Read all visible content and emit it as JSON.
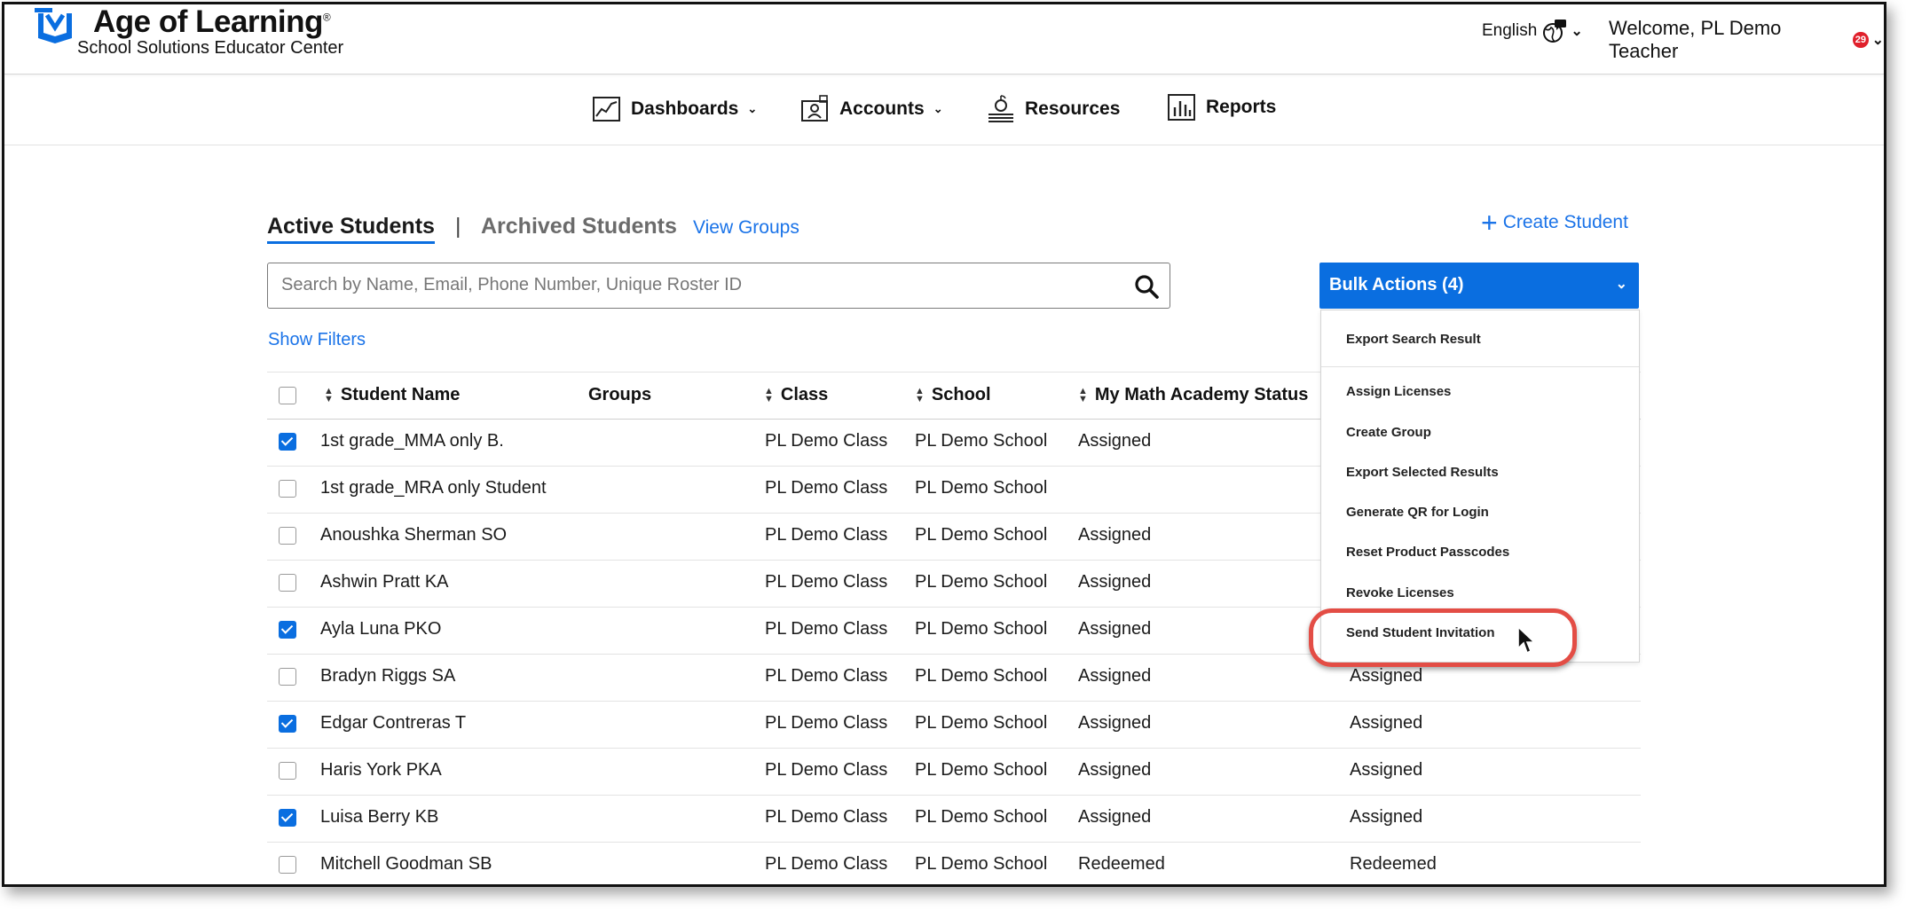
{
  "header": {
    "brand_title": "Age of Learning",
    "brand_registered": "®",
    "brand_subtitle": "School Solutions Educator Center",
    "language": "English",
    "welcome": "Welcome, PL Demo Teacher",
    "notification_count": "29"
  },
  "nav": {
    "dashboards": "Dashboards",
    "accounts": "Accounts",
    "resources": "Resources",
    "reports": "Reports"
  },
  "tabs": {
    "active": "Active Students",
    "separator": "|",
    "archived": "Archived Students",
    "groups": "View Groups"
  },
  "create_student": "Create Student",
  "search": {
    "placeholder": "Search by Name, Email, Phone Number, Unique Roster ID"
  },
  "show_filters": "Show Filters",
  "bulk_actions": {
    "label": "Bulk Actions (4)",
    "items": [
      "Export Search Result",
      "Assign Licenses",
      "Create Group",
      "Export Selected Results",
      "Generate QR for Login",
      "Reset Product Passcodes",
      "Revoke Licenses",
      "Send Student Invitation"
    ]
  },
  "table": {
    "headers": [
      "Student Name",
      "Groups",
      "Class",
      "School",
      "My Math Academy Status"
    ],
    "rows": [
      {
        "name": "1st grade_MMA only B.",
        "class": "PL Demo Class",
        "school": "PL Demo School",
        "status": "Assigned",
        "status2": "",
        "checked": true
      },
      {
        "name": "1st grade_MRA only Student",
        "class": "PL Demo Class",
        "school": "PL Demo School",
        "status": "",
        "status2": "",
        "checked": false
      },
      {
        "name": "Anoushka Sherman SO",
        "class": "PL Demo Class",
        "school": "PL Demo School",
        "status": "Assigned",
        "status2": "",
        "checked": false
      },
      {
        "name": "Ashwin Pratt KA",
        "class": "PL Demo Class",
        "school": "PL Demo School",
        "status": "Assigned",
        "status2": "",
        "checked": false
      },
      {
        "name": "Ayla Luna PKO",
        "class": "PL Demo Class",
        "school": "PL Demo School",
        "status": "Assigned",
        "status2": "",
        "checked": true
      },
      {
        "name": "Bradyn Riggs SA",
        "class": "PL Demo Class",
        "school": "PL Demo School",
        "status": "Assigned",
        "status2": "Assigned",
        "checked": false
      },
      {
        "name": "Edgar Contreras T",
        "class": "PL Demo Class",
        "school": "PL Demo School",
        "status": "Assigned",
        "status2": "Assigned",
        "checked": true
      },
      {
        "name": "Haris York PKA",
        "class": "PL Demo Class",
        "school": "PL Demo School",
        "status": "Assigned",
        "status2": "Assigned",
        "checked": false
      },
      {
        "name": "Luisa Berry KB",
        "class": "PL Demo Class",
        "school": "PL Demo School",
        "status": "Assigned",
        "status2": "Assigned",
        "checked": true
      },
      {
        "name": "Mitchell Goodman SB",
        "class": "PL Demo Class",
        "school": "PL Demo School",
        "status": "Redeemed",
        "status2": "Redeemed",
        "checked": false
      }
    ]
  },
  "colors": {
    "accent": "#0a6ee0",
    "link": "#1a73e8",
    "highlight": "#e34d45",
    "badge": "#e0202b"
  },
  "icons": [
    "logo-icon",
    "globe-icon",
    "chevron-down-icon",
    "dashboard-chart-icon",
    "accounts-icon",
    "resources-icon",
    "reports-icon",
    "plus-icon",
    "search-icon",
    "sort-icon",
    "cursor-icon"
  ]
}
